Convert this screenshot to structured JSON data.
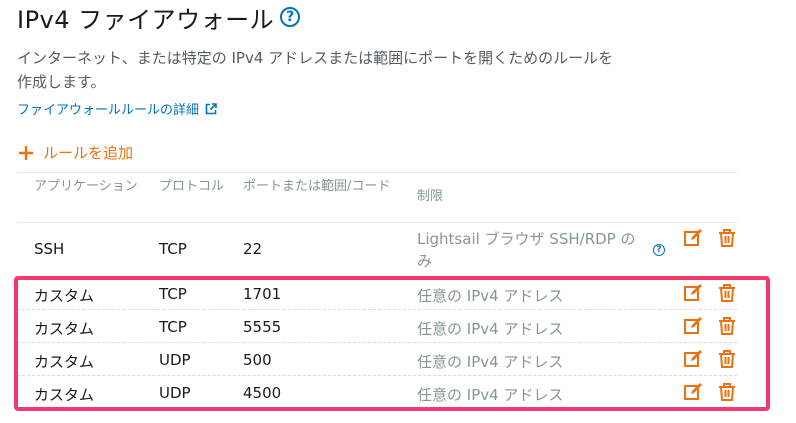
{
  "header": {
    "title": "IPv4 ファイアウォール",
    "help_symbol": "?"
  },
  "description": "インターネット、または特定の IPv4 アドレスまたは範囲にポートを開くためのルールを作成します。",
  "details_link": "ファイアウォールルールの詳細",
  "add_rule_label": "ルールを追加",
  "table": {
    "headers": {
      "application": "アプリケーション",
      "protocol": "プロトコル",
      "port": "ポートまたは範囲/コード",
      "restriction": "制限"
    },
    "rows": [
      {
        "application": "SSH",
        "protocol": "TCP",
        "port": "22",
        "restriction": "Lightsail ブラウザ SSH/RDP のみ"
      },
      {
        "application": "カスタム",
        "protocol": "TCP",
        "port": "1701",
        "restriction": "任意の IPv4 アドレス"
      },
      {
        "application": "カスタム",
        "protocol": "TCP",
        "port": "5555",
        "restriction": "任意の IPv4 アドレス"
      },
      {
        "application": "カスタム",
        "protocol": "UDP",
        "port": "500",
        "restriction": "任意の IPv4 アドレス"
      },
      {
        "application": "カスタム",
        "protocol": "UDP",
        "port": "4500",
        "restriction": "任意の IPv4 アドレス"
      }
    ]
  },
  "colors": {
    "accent": "#ec7211",
    "link": "#0073bb",
    "highlight": "#f23a6f"
  },
  "icons": {
    "edit": "edit-icon",
    "delete": "trash-icon",
    "external": "external-link-icon"
  }
}
